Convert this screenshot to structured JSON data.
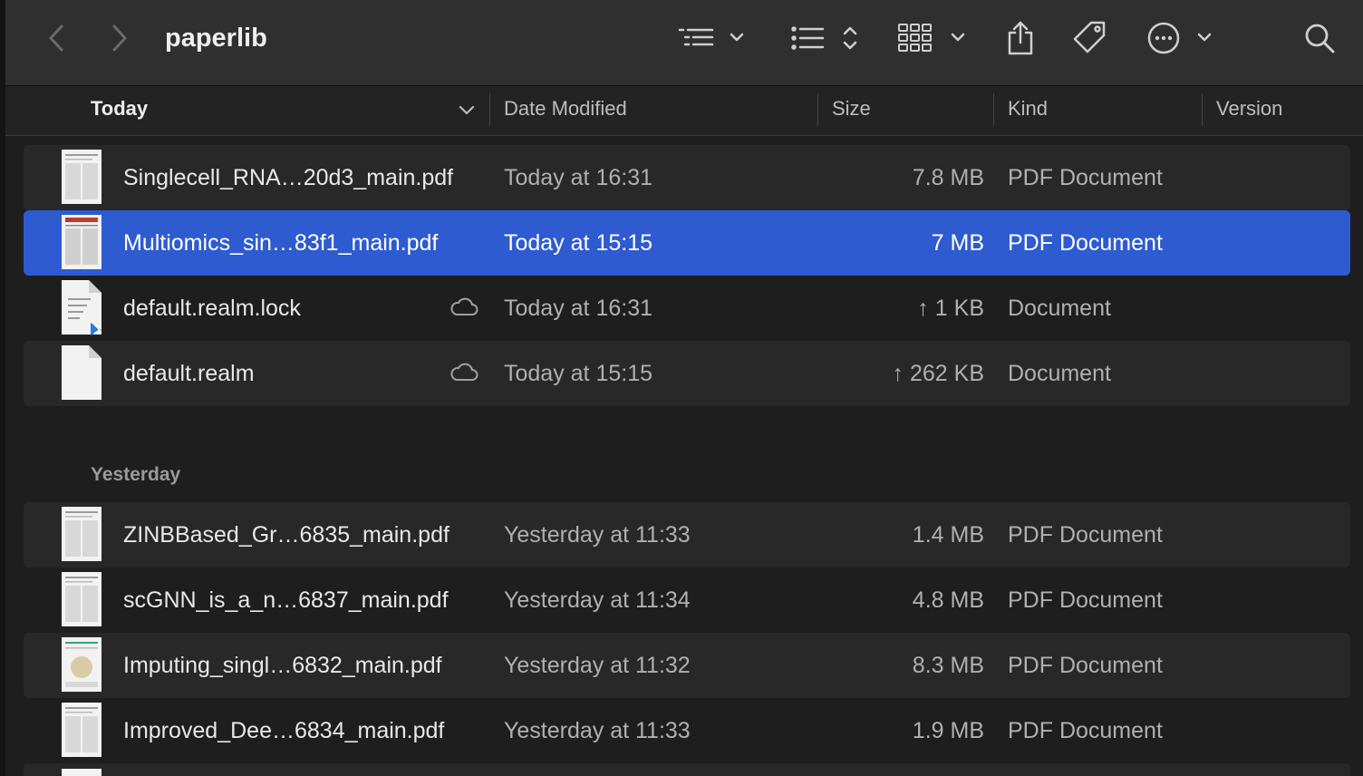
{
  "window": {
    "title": "paperlib"
  },
  "toolbar": {
    "icons": [
      "back-icon",
      "forward-icon",
      "group-by-icon",
      "sort-list-icon",
      "view-gallery-icon",
      "share-icon",
      "tag-icon",
      "more-actions-icon",
      "search-icon"
    ]
  },
  "columns": {
    "name": "Today",
    "date": "Date Modified",
    "size": "Size",
    "kind": "Kind",
    "version": "Version"
  },
  "groups": [
    {
      "label": "Today",
      "rows": [
        {
          "name": "Singlecell_RNA…20d3_main.pdf",
          "date": "Today at 16:31",
          "size": "7.8 MB",
          "kind": "PDF Document",
          "icon": "pdf-thumbnail-icon"
        },
        {
          "name": "Multiomics_sin…83f1_main.pdf",
          "date": "Today at 15:15",
          "size": "7 MB",
          "kind": "PDF Document",
          "icon": "pdf-thumbnail-icon",
          "selected": true
        },
        {
          "name": "default.realm.lock",
          "date": "Today at 16:31",
          "size": "↑ 1 KB",
          "kind": "Document",
          "icon": "text-document-icon",
          "cloud": true
        },
        {
          "name": "default.realm",
          "date": "Today at 15:15",
          "size": "↑ 262 KB",
          "kind": "Document",
          "icon": "blank-document-icon",
          "cloud": true
        }
      ]
    },
    {
      "label": "Yesterday",
      "rows": [
        {
          "name": "ZINBBased_Gr…6835_main.pdf",
          "date": "Yesterday at 11:33",
          "size": "1.4 MB",
          "kind": "PDF Document",
          "icon": "pdf-thumbnail-icon"
        },
        {
          "name": "scGNN_is_a_n…6837_main.pdf",
          "date": "Yesterday at 11:34",
          "size": "4.8 MB",
          "kind": "PDF Document",
          "icon": "pdf-thumbnail-icon"
        },
        {
          "name": "Imputing_singl…6832_main.pdf",
          "date": "Yesterday at 11:32",
          "size": "8.3 MB",
          "kind": "PDF Document",
          "icon": "pdf-thumbnail-icon"
        },
        {
          "name": "Improved_Dee…6834_main.pdf",
          "date": "Yesterday at 11:33",
          "size": "1.9 MB",
          "kind": "PDF Document",
          "icon": "pdf-thumbnail-icon"
        }
      ]
    }
  ]
}
